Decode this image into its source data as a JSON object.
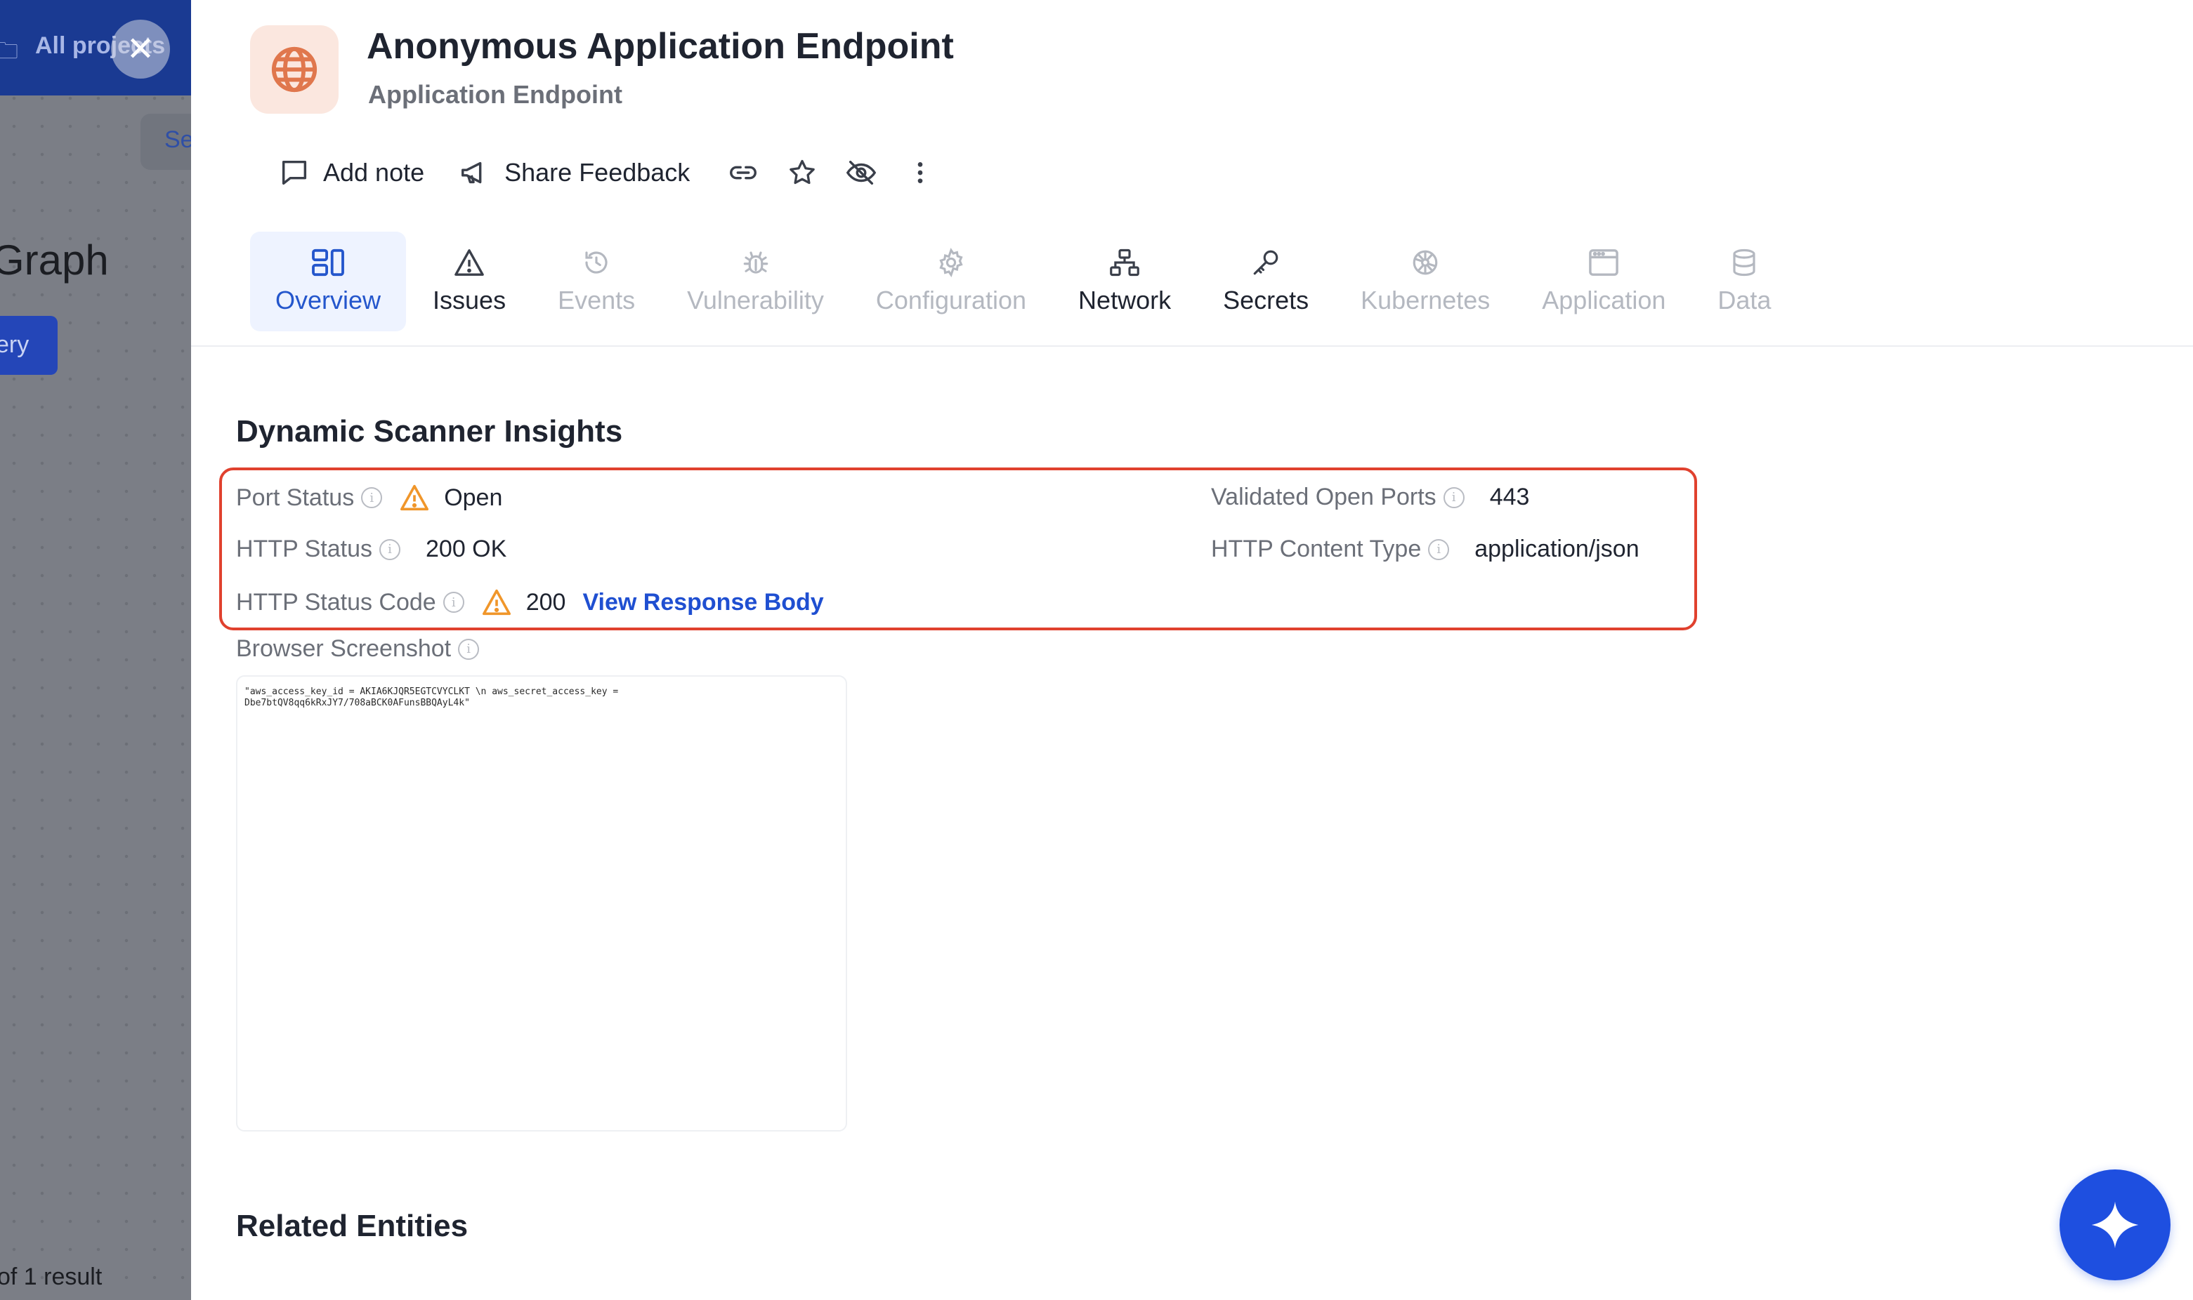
{
  "background": {
    "all_projects": "All projects",
    "search_fragment": "Se",
    "graph_fragment": "Graph",
    "query_fragment": "ery",
    "result_fragment": "of 1 result"
  },
  "header": {
    "title": "Anonymous Application Endpoint",
    "subtitle": "Application Endpoint",
    "icon": "globe-icon"
  },
  "toolbar": {
    "add_note": "Add note",
    "share_feedback": "Share Feedback",
    "icons": [
      "link-icon",
      "star-icon",
      "eye-off-icon",
      "more-vertical-icon"
    ]
  },
  "tabs": [
    {
      "label": "Overview",
      "icon": "overview-icon",
      "state": "active"
    },
    {
      "label": "Issues",
      "icon": "warning-icon",
      "state": "enabled"
    },
    {
      "label": "Events",
      "icon": "history-icon",
      "state": "disabled"
    },
    {
      "label": "Vulnerability",
      "icon": "bug-icon",
      "state": "disabled"
    },
    {
      "label": "Configuration",
      "icon": "gear-icon",
      "state": "disabled"
    },
    {
      "label": "Network",
      "icon": "network-icon",
      "state": "enabled"
    },
    {
      "label": "Secrets",
      "icon": "key-icon",
      "state": "enabled"
    },
    {
      "label": "Kubernetes",
      "icon": "kubernetes-icon",
      "state": "disabled"
    },
    {
      "label": "Application",
      "icon": "application-icon",
      "state": "disabled"
    },
    {
      "label": "Data",
      "icon": "database-icon",
      "state": "disabled"
    }
  ],
  "insights": {
    "title": "Dynamic Scanner Insights",
    "port_status": {
      "label": "Port Status",
      "value": "Open"
    },
    "validated_open_ports": {
      "label": "Validated Open Ports",
      "value": "443"
    },
    "http_status": {
      "label": "HTTP Status",
      "value": "200 OK"
    },
    "http_content_type": {
      "label": "HTTP Content Type",
      "value": "application/json"
    },
    "http_status_code": {
      "label": "HTTP Status Code",
      "value": "200",
      "link": "View Response Body"
    },
    "browser_screenshot": {
      "label": "Browser Screenshot",
      "text": "\"aws_access_key_id = AKIA6KJQR5EGTCVYCLKT \\n aws_secret_access_key =\n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\""
    }
  },
  "related_entities": {
    "title": "Related Entities"
  },
  "colors": {
    "accent": "#2456cc",
    "link": "#1f4fd1",
    "warning": "#f0962a",
    "highlight_border": "#e0412e",
    "ai_button": "#1e4fe0"
  }
}
